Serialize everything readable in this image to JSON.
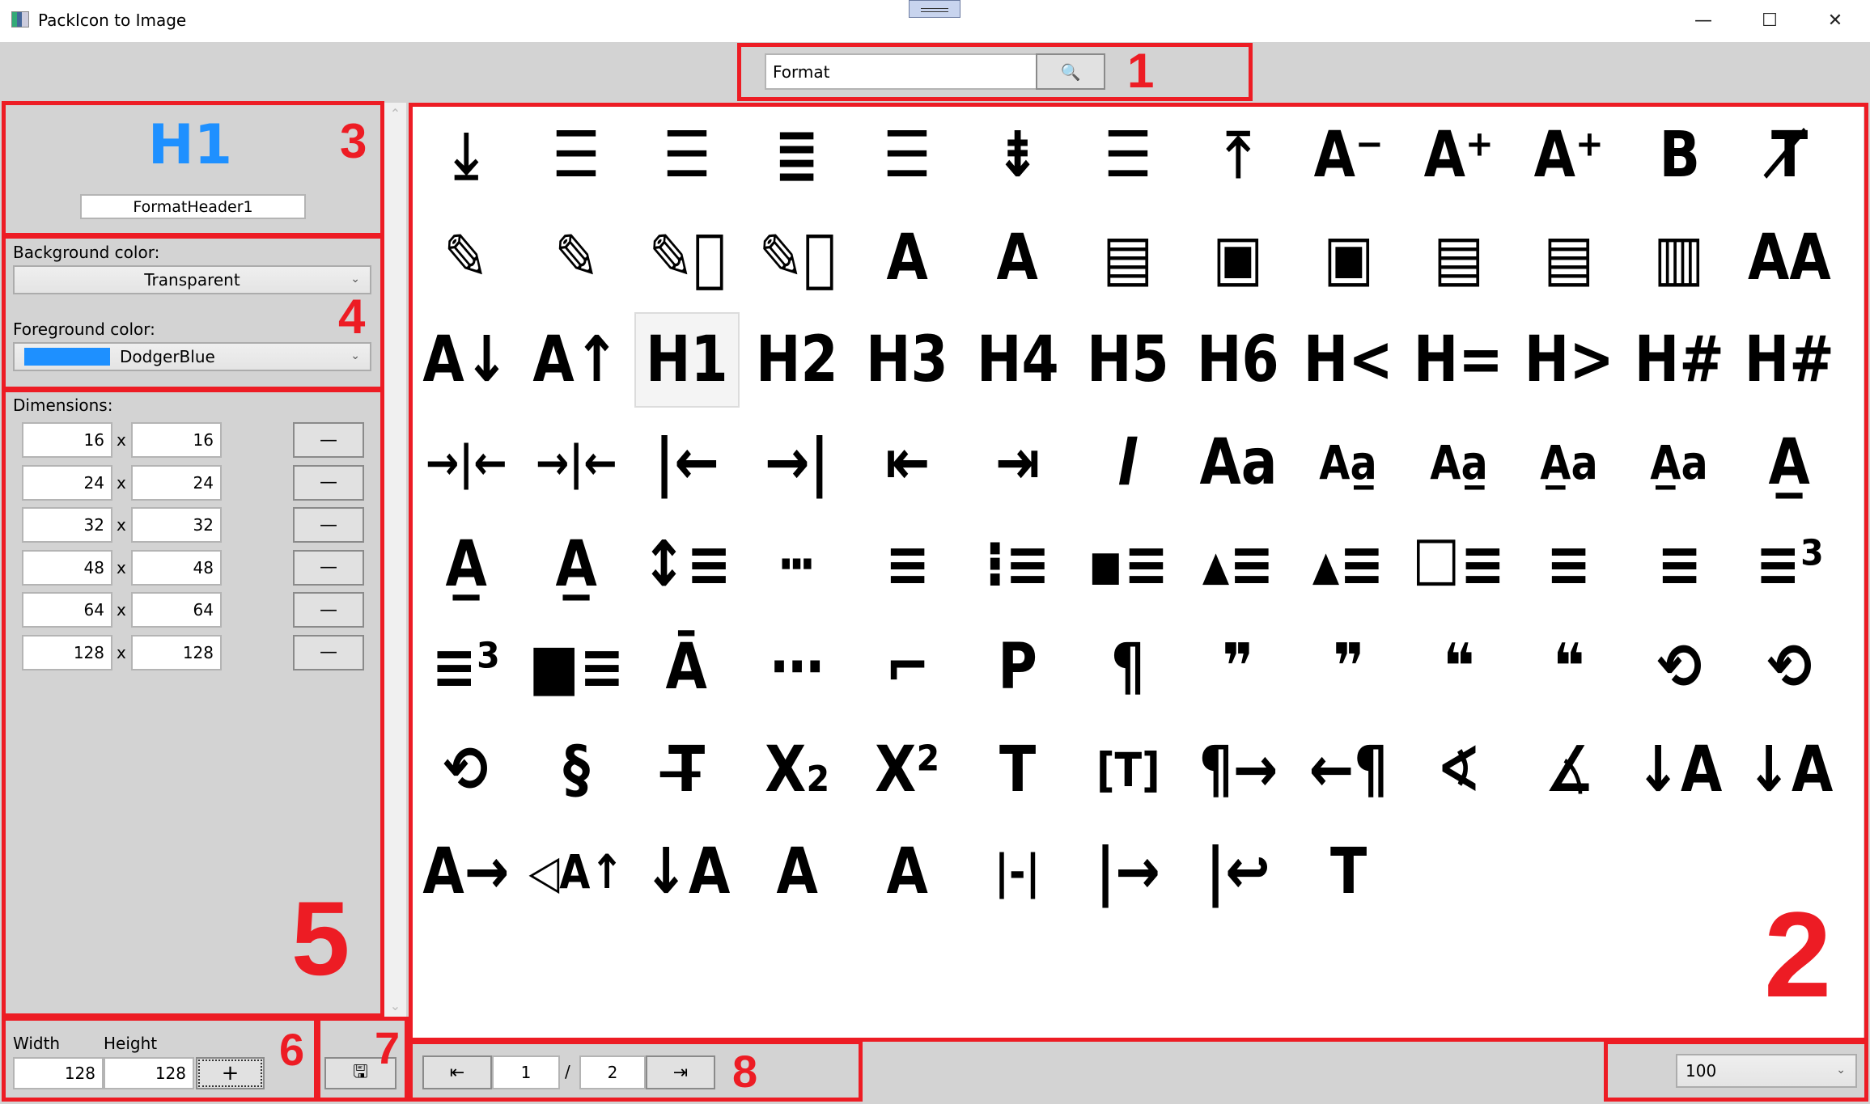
{
  "window": {
    "title": "PackIcon to Image",
    "minimize": "—",
    "maximize": "☐",
    "close": "✕"
  },
  "search": {
    "value": "Format",
    "button_icon": "search-icon",
    "glyph": "🔍"
  },
  "preview": {
    "icon_text": "H1",
    "icon_color": "#1e90ff",
    "name": "FormatHeader1"
  },
  "colors": {
    "background_label": "Background color:",
    "background_value": "Transparent",
    "foreground_label": "Foreground color:",
    "foreground_value": "DodgerBlue",
    "foreground_swatch": "#1e90ff"
  },
  "dimensions": {
    "label": "Dimensions:",
    "sep": "x",
    "remove_label": "—",
    "rows": [
      {
        "w": "16",
        "h": "16"
      },
      {
        "w": "24",
        "h": "24"
      },
      {
        "w": "32",
        "h": "32"
      },
      {
        "w": "48",
        "h": "48"
      },
      {
        "w": "64",
        "h": "64"
      },
      {
        "w": "128",
        "h": "128"
      }
    ]
  },
  "add_size": {
    "width_label": "Width",
    "height_label": "Height",
    "width": "128",
    "height": "128",
    "add_label": "+"
  },
  "save": {
    "icon": "save-icon",
    "glyph": "🖫"
  },
  "paging": {
    "prev_glyph": "⇤",
    "current": "1",
    "sep": "/",
    "total": "2",
    "next_glyph": "⇥"
  },
  "zoom": {
    "value": "100"
  },
  "annotations": [
    "1",
    "2",
    "3",
    "4",
    "5",
    "6",
    "7",
    "8"
  ],
  "icons": [
    {
      "name": "format-align-bottom",
      "g": "⤓"
    },
    {
      "name": "format-align-center",
      "g": "☰"
    },
    {
      "name": "format-align-center",
      "g": "☰"
    },
    {
      "name": "format-align-justify",
      "g": "≣"
    },
    {
      "name": "format-align-left",
      "g": "☰"
    },
    {
      "name": "format-align-middle",
      "g": "⇟"
    },
    {
      "name": "format-align-right",
      "g": "☰"
    },
    {
      "name": "format-align-top",
      "g": "⤒"
    },
    {
      "name": "format-font-size-decrease",
      "g": "A⁻"
    },
    {
      "name": "format-font-size-increase",
      "g": "A⁺"
    },
    {
      "name": "format-annotation-plus",
      "g": "A⁺"
    },
    {
      "name": "format-bold",
      "g": "B"
    },
    {
      "name": "format-clear",
      "g": "T̸"
    },
    {
      "name": "format-color-highlight",
      "g": "✎"
    },
    {
      "name": "format-color-marker",
      "g": "✎"
    },
    {
      "name": "format-color-marker-cancel",
      "g": "✎⃠"
    },
    {
      "name": "format-color-highlight-cancel",
      "g": "✎⃠"
    },
    {
      "name": "format-color-text",
      "g": "A"
    },
    {
      "name": "format-color-fill",
      "g": "A"
    },
    {
      "name": "format-columns",
      "g": "▤"
    },
    {
      "name": "format-float-center",
      "g": "▣"
    },
    {
      "name": "format-float-center-alt",
      "g": "▣"
    },
    {
      "name": "format-float-left",
      "g": "▤"
    },
    {
      "name": "format-float-left-alt",
      "g": "▤"
    },
    {
      "name": "format-float-right",
      "g": "▥"
    },
    {
      "name": "format-font",
      "g": "AA"
    },
    {
      "name": "format-font-size-down",
      "g": "A↓"
    },
    {
      "name": "format-font-size-up",
      "g": "A↑"
    },
    {
      "name": "format-header-1",
      "g": "H1"
    },
    {
      "name": "format-header-2",
      "g": "H2"
    },
    {
      "name": "format-header-3",
      "g": "H3"
    },
    {
      "name": "format-header-4",
      "g": "H4"
    },
    {
      "name": "format-header-5",
      "g": "H5"
    },
    {
      "name": "format-header-6",
      "g": "H6"
    },
    {
      "name": "format-header-decrease",
      "g": "H<"
    },
    {
      "name": "format-header-equal",
      "g": "H="
    },
    {
      "name": "format-header-increase",
      "g": "H>"
    },
    {
      "name": "format-header-pound",
      "g": "H#"
    },
    {
      "name": "format-header-pound-alt",
      "g": "H#"
    },
    {
      "name": "format-horizontal-align-center",
      "g": "→|←"
    },
    {
      "name": "format-horizontal-align-center-alt",
      "g": "→|←"
    },
    {
      "name": "format-horizontal-align-left",
      "g": "|←"
    },
    {
      "name": "format-horizontal-align-right",
      "g": "→|"
    },
    {
      "name": "format-indent-decrease",
      "g": "⇤"
    },
    {
      "name": "format-indent-increase",
      "g": "⇥"
    },
    {
      "name": "format-italic",
      "g": "𝑰"
    },
    {
      "name": "format-letter-case",
      "g": "Aa"
    },
    {
      "name": "format-letter-case-lower",
      "g": "Aa̲"
    },
    {
      "name": "format-letter-case-lower-alt",
      "g": "Aa̲"
    },
    {
      "name": "format-letter-case-upper",
      "g": "A̲a"
    },
    {
      "name": "format-letter-case-upper-alt",
      "g": "A̲a"
    },
    {
      "name": "format-letter-ends-with",
      "g": "A̲"
    },
    {
      "name": "format-letter-matches",
      "g": "A̲"
    },
    {
      "name": "format-letter-starts-with",
      "g": "A̲"
    },
    {
      "name": "format-line-spacing",
      "g": "↕≡"
    },
    {
      "name": "format-line-style",
      "g": "┅"
    },
    {
      "name": "format-line-weight",
      "g": "≡"
    },
    {
      "name": "format-list-bulleted",
      "g": "⁝≡"
    },
    {
      "name": "format-list-bulleted-square",
      "g": "▪≡"
    },
    {
      "name": "format-list-bulleted-triangle",
      "g": "▴≡"
    },
    {
      "name": "format-list-bulleted-type",
      "g": "▴≡"
    },
    {
      "name": "format-list-checkbox",
      "g": "☐≡"
    },
    {
      "name": "format-list-numbered",
      "g": "≡"
    },
    {
      "name": "format-list-numbered-alt",
      "g": "≡"
    },
    {
      "name": "format-list-numbered-rtl",
      "g": "≡³"
    },
    {
      "name": "format-list-numbered-rtl-alt",
      "g": "≡³"
    },
    {
      "name": "format-list-checks",
      "g": "■≡"
    },
    {
      "name": "format-overline",
      "g": "Ā"
    },
    {
      "name": "format-page-break",
      "g": "⋯"
    },
    {
      "name": "format-paint",
      "g": "⌐"
    },
    {
      "name": "format-pilcrow-p",
      "g": "P"
    },
    {
      "name": "format-pilcrow",
      "g": "¶"
    },
    {
      "name": "format-quote-close",
      "g": "❞"
    },
    {
      "name": "format-quote-close-outline",
      "g": "❞"
    },
    {
      "name": "format-quote-open",
      "g": "❝"
    },
    {
      "name": "format-quote-open-outline",
      "g": "❝"
    },
    {
      "name": "format-rotate-90",
      "g": "⟲"
    },
    {
      "name": "format-rotate-90-alt",
      "g": "⟲"
    },
    {
      "name": "format-rotate-90-left",
      "g": "⟲"
    },
    {
      "name": "format-section",
      "g": "§"
    },
    {
      "name": "format-strikethrough",
      "g": "T̶"
    },
    {
      "name": "format-subscript",
      "g": "X₂"
    },
    {
      "name": "format-superscript",
      "g": "X²"
    },
    {
      "name": "format-text",
      "g": "T"
    },
    {
      "name": "format-textbox",
      "g": "[T]"
    },
    {
      "name": "format-textdirection-l-to-r",
      "g": "¶→"
    },
    {
      "name": "format-textdirection-r-to-l",
      "g": "←¶"
    },
    {
      "name": "format-text-rotation-angle-down",
      "g": "∢"
    },
    {
      "name": "format-text-rotation-angle-up",
      "g": "∡"
    },
    {
      "name": "format-text-rotation-down",
      "g": "↓A"
    },
    {
      "name": "format-text-rotation-down-vertical",
      "g": "↓A"
    },
    {
      "name": "format-text-rotation-none",
      "g": "A→"
    },
    {
      "name": "format-text-rotation-up",
      "g": "◁A↑"
    },
    {
      "name": "format-text-rotation-vertical",
      "g": "↓A"
    },
    {
      "name": "format-text-variant",
      "g": "A"
    },
    {
      "name": "format-text-variant-outline",
      "g": "A"
    },
    {
      "name": "format-text-wrapping-clip",
      "g": "|-|"
    },
    {
      "name": "format-text-wrapping-overflow",
      "g": "|→"
    },
    {
      "name": "format-text-wrapping-wrap",
      "g": "|↩"
    },
    {
      "name": "format-title",
      "g": "T"
    }
  ]
}
